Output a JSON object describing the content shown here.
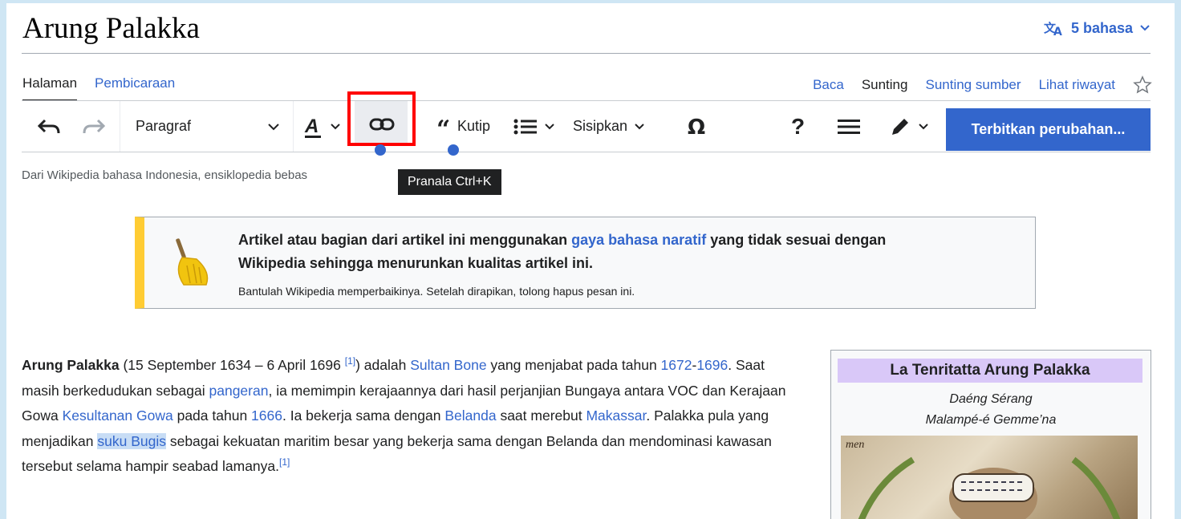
{
  "page_title": "Arung Palakka",
  "language": {
    "label": "5 bahasa"
  },
  "tabs_left": [
    "Halaman",
    "Pembicaraan"
  ],
  "tabs_right": [
    "Baca",
    "Sunting",
    "Sunting sumber",
    "Lihat riwayat"
  ],
  "toolbar": {
    "paragraph_label": "Paragraf",
    "quote_label": "Kutip",
    "insert_label": "Sisipkan",
    "help_label": "?",
    "publish_label": "Terbitkan perubahan..."
  },
  "tagline": "Dari Wikipedia bahasa Indonesia, ensiklopedia bebas",
  "tooltip": "Pranala Ctrl+K",
  "ambox": {
    "line1_pre": "Artikel atau bagian dari artikel ini menggunakan ",
    "line1_link": "gaya bahasa naratif",
    "line1_post": " yang tidak sesuai dengan",
    "line2": "Wikipedia sehingga menurunkan kualitas artikel ini.",
    "small": "Bantulah Wikipedia memperbaikinya. Setelah dirapikan, tolong hapus pesan ini."
  },
  "body": {
    "bold_name": "Arung Palakka",
    "t1": " (15 September 1634 – 6 April 1696 ",
    "ref1": "[1]",
    "t2": ") adalah ",
    "l_sultan": "Sultan Bone",
    "t3": " yang menjabat pada tahun ",
    "l_1672": "1672",
    "dash": "-",
    "l_1696": "1696",
    "t4": ". Saat masih berkedudukan sebagai ",
    "l_pangeran": "pangeran",
    "t5": ", ia memimpin kerajaannya dari hasil perjanjian Bungaya antara VOC dan Kerajaan Gowa ",
    "l_gowa": "Kesultanan Gowa",
    "t6": " pada tahun ",
    "l_1666": "1666",
    "t7": ". Ia bekerja sama dengan ",
    "l_belanda": "Belanda",
    "t8": " saat merebut ",
    "l_makassar": "Makassar",
    "t9": ". Palakka pula yang menjadikan ",
    "l_bugis": "suku Bugis",
    "t10": " sebagai kekuatan maritim besar yang bekerja sama dengan Belanda dan mendominasi kawasan tersebut selama hampir seabad lamanya.",
    "ref2": "[1]"
  },
  "infobox": {
    "title": "La Tenritatta Arung Palakka",
    "sub1": "Daéng Sérang",
    "sub2": "Malampé-é Gemme’na",
    "img_text": "men"
  },
  "colors": {
    "link": "#3366cc",
    "publish": "#3366cc",
    "highlight_box": "#ff0000",
    "ambox_border": "#ffcc33"
  }
}
